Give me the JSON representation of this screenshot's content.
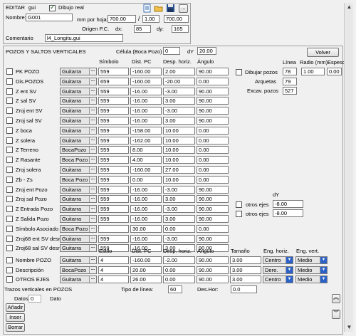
{
  "top": {
    "editar_label": "EDITAR",
    "editar_value": "gui",
    "dibujo_real": "Dibujo real",
    "nombre_label": "Nombre:",
    "nombre_value": "G001",
    "mm_hoja_label": "mm por hoja:",
    "mm_hoja_value": "700.00",
    "slash": "/",
    "ratio_1": "1.00",
    "ratio_2": "700.00",
    "origen_label": "Origen P.C.",
    "dx_label": "dx:",
    "dx_value": "85",
    "dy_label": "dy:",
    "dy_value": "165",
    "comentario_label": "Comentario",
    "comentario_value": "l4_Longitu.gui",
    "ellipsis": "..."
  },
  "pozos": {
    "title": "POZOS Y SALTOS VERTICALES",
    "celula_label": "Célula (Boca Pozo)",
    "celula_value": "0",
    "dy_label": "dY",
    "dy_value": "20.00",
    "volver": "Volver",
    "col_simbolo": "Símbolo",
    "col_dist": "Dist. PC",
    "col_desp": "Desp. horiz.",
    "col_angulo": "Ángulo",
    "rows": [
      {
        "label": "PK POZO",
        "combo": "Guitarra",
        "sym": "559",
        "dist": "-160.00",
        "desp": "2.00",
        "ang": "90.00"
      },
      {
        "label": "Dis.POZOS",
        "combo": "Guitarra",
        "sym": "659",
        "dist": "-160.00",
        "desp": "-20.00",
        "ang": "0.00"
      },
      {
        "label": "Z ent SV",
        "combo": "Guitarra",
        "sym": "559",
        "dist": "-16.00",
        "desp": "-3.00",
        "ang": "90.00"
      },
      {
        "label": "Z sal SV",
        "combo": "Guitarra",
        "sym": "559",
        "dist": "-16.00",
        "desp": "3.00",
        "ang": "90.00"
      },
      {
        "label": "Zroj ent SV",
        "combo": "Guitarra",
        "sym": "559",
        "dist": "-16.00",
        "desp": "-3.00",
        "ang": "90.00"
      },
      {
        "label": "Zroj sal SV",
        "combo": "Guitarra",
        "sym": "559",
        "dist": "-16.00",
        "desp": "3.00",
        "ang": "90.00"
      },
      {
        "label": "Z boca",
        "combo": "Guitarra",
        "sym": "559",
        "dist": "-158.00",
        "desp": "10.00",
        "ang": "0.00"
      },
      {
        "label": "Z solera",
        "combo": "Guitarra",
        "sym": "559",
        "dist": "-162.00",
        "desp": "10.00",
        "ang": "0.00"
      },
      {
        "label": "Z Terreno",
        "combo": "BocaPozo",
        "sym": "559",
        "dist": "8.00",
        "desp": "10.00",
        "ang": "0.00"
      },
      {
        "label": "Z Rasante",
        "combo": "Boca Pozo",
        "sym": "559",
        "dist": "4.00",
        "desp": "10.00",
        "ang": "0.00"
      },
      {
        "label": "Zroj solera",
        "combo": "Guitarra",
        "sym": "559",
        "dist": "-160.00",
        "desp": "27.00",
        "ang": "0.00"
      },
      {
        "label": "Zb - Zs",
        "combo": "Boca Pozo",
        "sym": "559",
        "dist": "0.00",
        "desp": "10.00",
        "ang": "0.00"
      },
      {
        "label": "Zroj ent Pozo",
        "combo": "Guitarra",
        "sym": "559",
        "dist": "-16.00",
        "desp": "-3.00",
        "ang": "90.00"
      },
      {
        "label": "Zroj sal Pozo",
        "combo": "Guitarra",
        "sym": "559",
        "dist": "-16.00",
        "desp": "3.00",
        "ang": "90.00"
      },
      {
        "label": "Z Entrada Pozo",
        "combo": "Guitarra",
        "sym": "559",
        "dist": "-16.00",
        "desp": "-3.00",
        "ang": "90.00"
      },
      {
        "label": "Z Salida Pozo",
        "combo": "Guitarra",
        "sym": "559",
        "dist": "-16.00",
        "desp": "3.00",
        "ang": "90.00"
      },
      {
        "label": "Símbolo Asociado",
        "combo": "Boca Pozo",
        "sym": "",
        "dist": "30.00",
        "desp": "0.00",
        "ang": "0.00"
      },
      {
        "label": "Zroj68 ent SV desnivel",
        "combo": "Guitarra",
        "sym": "559",
        "dist": "-16.00",
        "desp": "-3.00",
        "ang": "90.00"
      },
      {
        "label": "Zroj68 sal SV desnivel",
        "combo": "Guitarra",
        "sym": "559",
        "dist": "-16.00",
        "desp": "3.00",
        "ang": "90.00"
      }
    ],
    "dibujar_pozos": "Dibujar pozos",
    "linea_label": "Línea",
    "radio_label": "Radio (mm)",
    "espesor_label": "Espesor",
    "linea_value": "78",
    "radio_value": "1.00",
    "espesor_value": "0.00",
    "arquetas_label": "Arquetas",
    "arquetas_value": "79",
    "excav_label": "Excav. pozos",
    "excav_value": "527",
    "dy2_label": "dY",
    "otros_ejes_1": "otros ejes",
    "otros_val_1": "-8.00",
    "otros_ejes_2": "otros ejes",
    "otros_val_2": "-8.00"
  },
  "names": {
    "col_estilo": "Estilo",
    "col_dist": "Dist. PC",
    "col_desp": "Desp. horiz.",
    "col_angulo": "Ángulo",
    "col_tamano": "Tamaño",
    "col_eng_h": "Eng. horiz.",
    "col_eng_v": "Eng. vert.",
    "rows": [
      {
        "label": "Nombre POZO",
        "combo": "Guitarra",
        "est": "4",
        "dist": "-160.00",
        "desp": "-2.00",
        "ang": "90.00",
        "tam": "3.00",
        "eh": "Centro",
        "ev": "Medio"
      },
      {
        "label": "Descripción",
        "combo": "BocaPozo",
        "est": "4",
        "dist": "20.00",
        "desp": "0.00",
        "ang": "90.00",
        "tam": "3.00",
        "eh": "Dere.",
        "ev": "Medio"
      },
      {
        "label": "OTROS EJES",
        "combo": "Guitarra",
        "est": "4",
        "dist": "26.00",
        "desp": "0.00",
        "ang": "90.00",
        "tam": "3.00",
        "eh": "Centro",
        "ev": "Medio"
      }
    ]
  },
  "bottom": {
    "trazos_label": "Trazos verticales en POZOS",
    "tipo_linea_label": "Tipo de línea:",
    "tipo_linea_value": "60",
    "des_hor_label": "Des.Hor:",
    "des_hor_value": "0.0",
    "datos_label": "Datos",
    "datos_value": "0",
    "dato_label": "Dato",
    "anadir": "Añadir",
    "inser": "Inser",
    "borrar": "Borrar"
  }
}
